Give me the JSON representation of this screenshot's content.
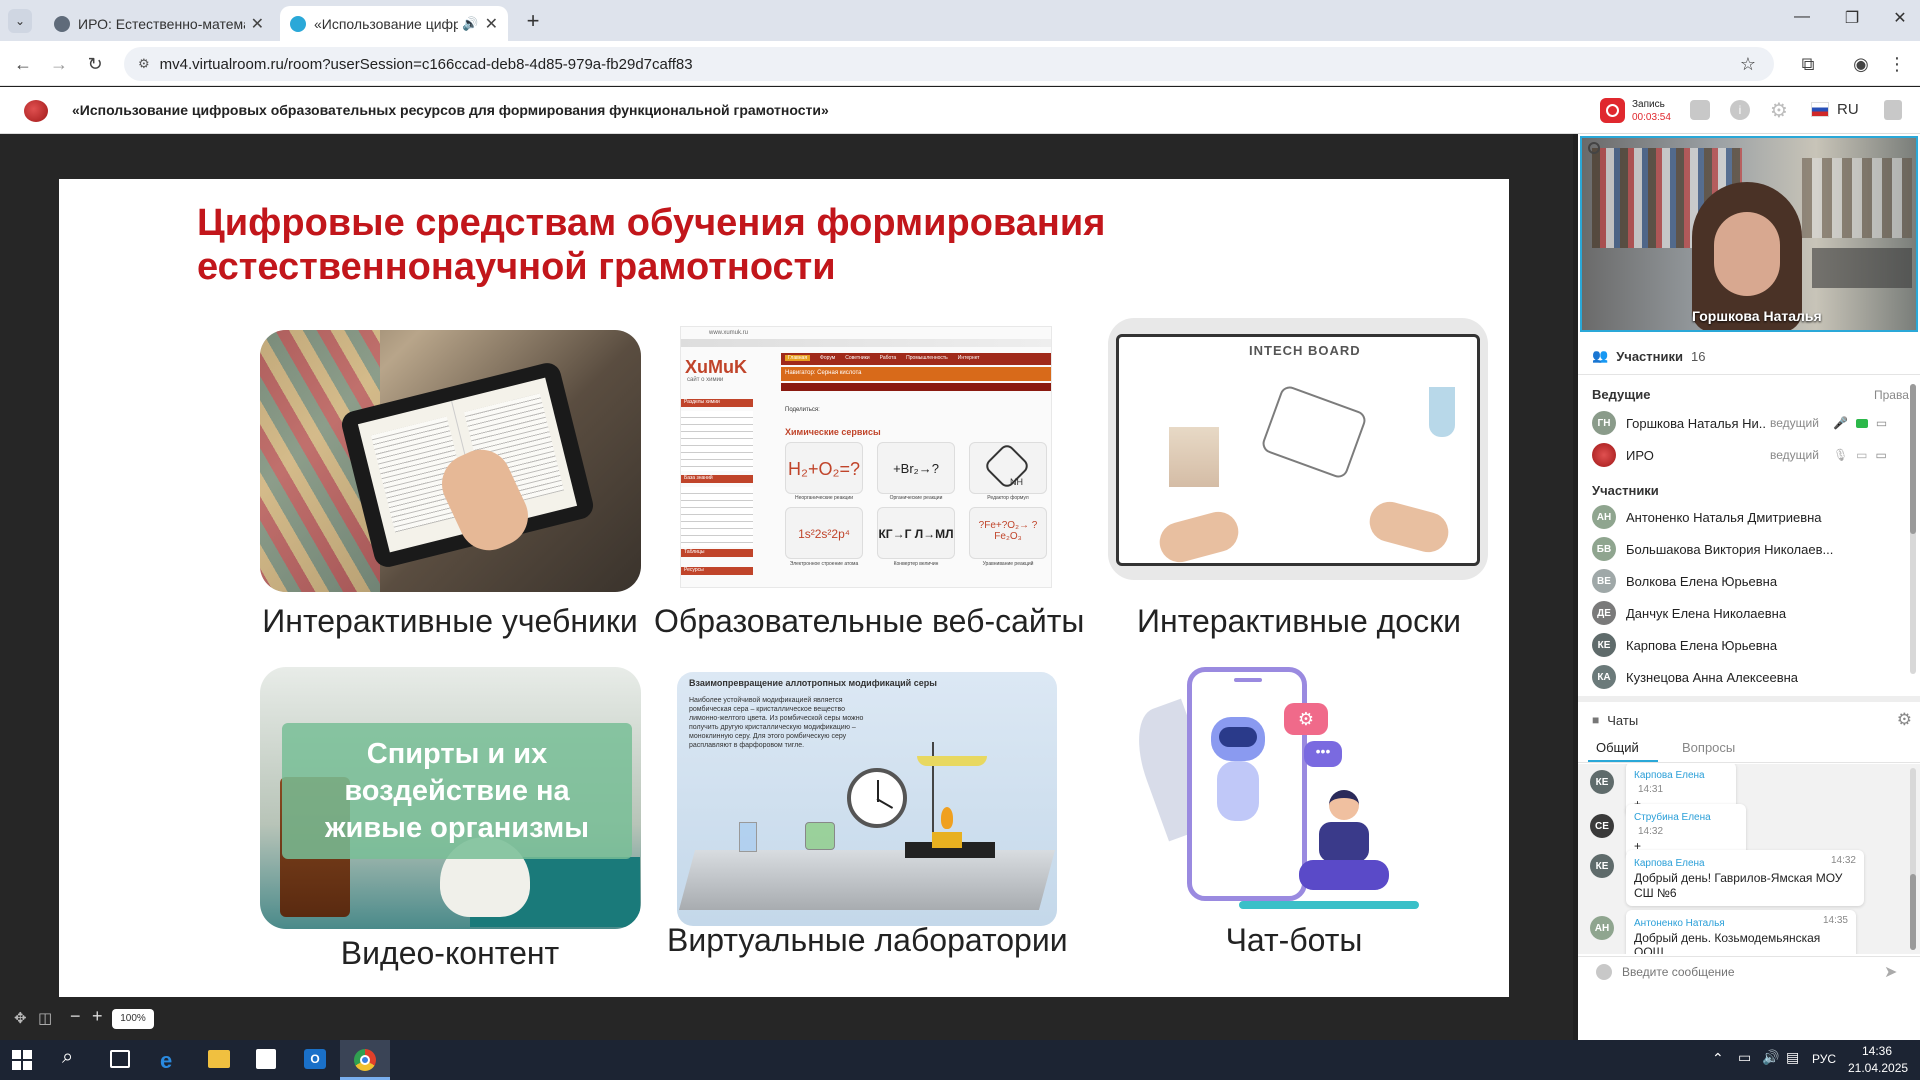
{
  "browser": {
    "tabs": [
      {
        "title": "ИРО: Естественно-математиче",
        "active": false
      },
      {
        "title": "«Использование цифров",
        "active": true
      }
    ],
    "address": "mv4.virtualroom.ru/room?userSession=c166ccad-deb8-4d85-979a-fb29d7caff83"
  },
  "app": {
    "room_title": "«Использование цифровых образовательных ресурсов для формирования функциональной грамотности»",
    "record_label": "Запись",
    "record_time": "00:03:54",
    "language": "RU"
  },
  "slide": {
    "title_line1": "Цифровые средствам обучения формирования",
    "title_line2": "естественнонаучной грамотности",
    "captions": [
      "Интерактивные учебники",
      "Образовательные веб-сайты",
      "Интерактивные доски",
      "Видео-контент",
      "Виртуальные лаборатории",
      "Чат-боты"
    ],
    "video_text": "Спирты и их воздействие на живые организмы",
    "lab_title": "Взаимопревращение аллотропных модификаций серы",
    "lab_text": "Наиболее устойчивой модификацией является ромбическая сера – кристаллическое вещество лимонно-желтого цвета. Из ромбической серы можно получить другую кристаллическую модификацию – моноклинную серу. Для этого ромбическую серу расплавляют в фарфоровом тигле.",
    "board_brand": "INTECH BOARD",
    "site_brand": "XuMuK",
    "site_sub": "сайт о химии",
    "site_services": "Химические сервисы",
    "site_share": "Поделиться:",
    "eq1": "H₂+O₂=?",
    "eq2": "+Br₂→?",
    "eq4": "1s²2s²2p⁴",
    "eq5": "КГ→Г  Л→МЛ",
    "eq6": "?Fe+?O₂→ ?Fe₂O₃",
    "nh": "NH",
    "eq_labels": [
      "Неорганические реакции",
      "Органические реакции",
      "Редактор формул",
      "Электронное строение атома",
      "Конвертер величин",
      "Уравнивание реакций"
    ],
    "site_url": "www.xumuk.ru",
    "site_crumb": "Навигатор: Серная кислота",
    "site_menu": [
      "Главная",
      "Форум",
      "Советники",
      "Работа",
      "Промышленность",
      "Интернет"
    ],
    "sidebar_sections": [
      "Разделы химии",
      "База знаний",
      "Таблицы",
      "Ресурсы"
    ]
  },
  "zoom": {
    "level": "100%"
  },
  "video": {
    "speaker_name": "Горшкова Наталья"
  },
  "participants": {
    "label": "Участники",
    "count": "16",
    "hosts_label": "Ведущие",
    "rights_label": "Права",
    "host_role": "ведущий",
    "hosts": [
      {
        "initials": "ГН",
        "name": "Горшкова Наталья Ни...",
        "color": "#8a9b8a"
      },
      {
        "initials": "",
        "name": "ИРО",
        "color": "#c0392b"
      }
    ],
    "members_label": "Участники",
    "members": [
      {
        "initials": "АН",
        "name": "Антоненко Наталья Дмитриевна",
        "color": "#8fa58f"
      },
      {
        "initials": "БВ",
        "name": "Большакова Виктория Николаев...",
        "color": "#8fa58f"
      },
      {
        "initials": "ВЕ",
        "name": "Волкова Елена Юрьевна",
        "color": "#9fa8a8"
      },
      {
        "initials": "ДЕ",
        "name": "Данчук Елена Николаевна",
        "color": "#7a7a7a"
      },
      {
        "initials": "КЕ",
        "name": "Карпова Елена Юрьевна",
        "color": "#5f6b6b"
      },
      {
        "initials": "КА",
        "name": "Кузнецова Анна Алексеевна",
        "color": "#6b7a7a"
      }
    ]
  },
  "chat": {
    "label": "Чаты",
    "tabs": [
      "Общий",
      "Вопросы"
    ],
    "messages": [
      {
        "initials": "КЕ",
        "name": "Карпова Елена",
        "time": "14:31",
        "text": "+"
      },
      {
        "initials": "СЕ",
        "name": "Струбина Елена",
        "time": "14:32",
        "text": "+"
      },
      {
        "initials": "КЕ",
        "name": "Карпова Елена",
        "time": "14:32",
        "text": "Добрый день! Гаврилов-Ямская МОУ СШ №6"
      },
      {
        "initials": "АН",
        "name": "Антоненко Наталья",
        "time": "14:35",
        "text": "Добрый день. Козьмодемьянская ООШ"
      }
    ],
    "placeholder": "Введите сообщение"
  },
  "taskbar": {
    "lang": "РУС",
    "time": "14:36",
    "date": "21.04.2025"
  }
}
